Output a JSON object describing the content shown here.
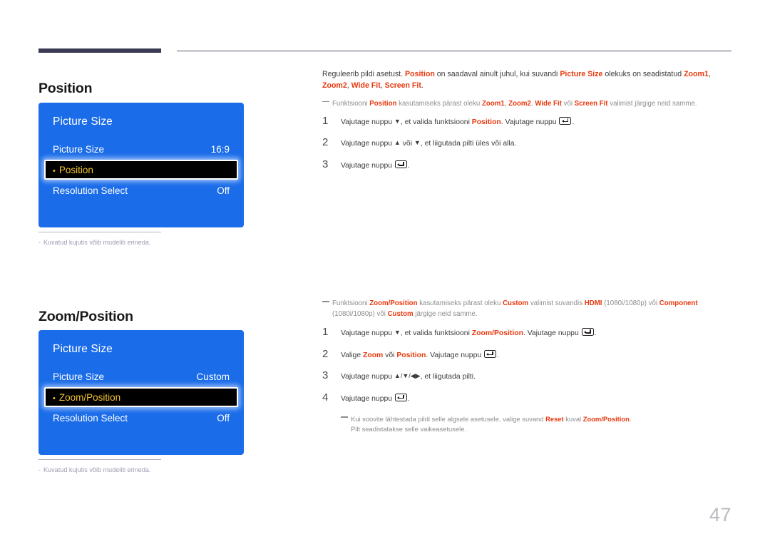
{
  "page": {
    "number": "47"
  },
  "sections": [
    {
      "heading": "Position",
      "osd": {
        "title": "Picture Size",
        "rows": [
          {
            "label": "Picture Size",
            "value": "16:9",
            "highlighted": false
          },
          {
            "label": "Position",
            "value": "",
            "highlighted": true
          },
          {
            "label": "Resolution Select",
            "value": "Off",
            "highlighted": false
          }
        ]
      },
      "caption": {
        "dash": "-",
        "text": "Kuvatud kujutis võib mudeliti erineda."
      },
      "intro": {
        "part1": "Reguleerib pildi asetust. ",
        "kw1": "Position",
        "part2": " on saadaval ainult juhul, kui suvandi ",
        "kw2": "Picture Size",
        "part3": " olekuks on seadistatud ",
        "kw3": "Zoom1",
        "sep1": ", ",
        "kw4": "Zoom2",
        "sep2": ", ",
        "kw5": "Wide Fit",
        "sep3": ", ",
        "kw6": "Screen Fit",
        "part4": "."
      },
      "note": {
        "part1": "Funktsiooni ",
        "kw1": "Position",
        "part2": " kasutamiseks pärast oleku ",
        "kw2": "Zoom1",
        "sep1": ", ",
        "kw3": "Zoom2",
        "sep2": ", ",
        "kw4": "Wide Fit",
        "part3": " või ",
        "kw5": "Screen Fit",
        "part4": " valimist järgige neid samme."
      },
      "steps": [
        {
          "num": "1",
          "t1": "Vajutage nuppu ",
          "arrow": "▼",
          "t2": ", et valida funktsiooni ",
          "kw": "Position",
          "t3": ". Vajutage nuppu ",
          "t4": "."
        },
        {
          "num": "2",
          "t1": "Vajutage nuppu ",
          "arrow": "▲",
          "t2": " või ",
          "arrow2": "▼",
          "t3": ", et liigutada pilti üles või alla."
        },
        {
          "num": "3",
          "t1": "Vajutage nuppu ",
          "t2": "."
        }
      ]
    },
    {
      "heading": "Zoom/Position",
      "osd": {
        "title": "Picture Size",
        "rows": [
          {
            "label": "Picture Size",
            "value": "Custom",
            "highlighted": false
          },
          {
            "label": "Zoom/Position",
            "value": "",
            "highlighted": true
          },
          {
            "label": "Resolution Select",
            "value": "Off",
            "highlighted": false
          }
        ]
      },
      "caption": {
        "dash": "-",
        "text": "Kuvatud kujutis võib mudeliti erineda."
      },
      "note": {
        "part1": "Funktsiooni ",
        "kw1": "Zoom/Position",
        "part2": " kasutamiseks pärast oleku ",
        "kw2": "Custom",
        "part3": " valimist suvandis ",
        "kw3": "HDMI",
        "part4": " (1080i/1080p) või ",
        "kw4": "Component",
        "part5": " (1080i/1080p) või ",
        "kw5": "Custom",
        "part6": " järgige neid samme."
      },
      "steps": [
        {
          "num": "1",
          "t1": "Vajutage nuppu ",
          "arrow": "▼",
          "t2": ", et valida funktsiooni ",
          "kw": "Zoom/Position",
          "t3": ". Vajutage nuppu ",
          "t4": "."
        },
        {
          "num": "2",
          "t1": "Valige ",
          "kw": "Zoom",
          "t2": " või ",
          "kw2": "Position",
          "t3": ". Vajutage nuppu ",
          "t4": "."
        },
        {
          "num": "3",
          "t1": "Vajutage nuppu ",
          "arrows": "▲/▼/◀▶",
          "t2": ", et liigutada pilti."
        },
        {
          "num": "4",
          "t1": "Vajutage nuppu ",
          "t2": "."
        }
      ],
      "subnote": {
        "part1": "Kui soovite lähtestada pildi selle algsele asetusele, valige suvand ",
        "kw1": "Reset",
        "part2": " kuval ",
        "kw2": "Zoom/Position",
        "part3": ".",
        "line2": "Pilt seadistatakse selle vaikeasetusele."
      }
    }
  ],
  "colors": {
    "accent_red": "#e8380d",
    "osd_blue": "#1a6ce9",
    "osd_highlight_text": "#f2c230",
    "rule_navy": "#3a3a55",
    "page_number": "#b9b9bf"
  }
}
